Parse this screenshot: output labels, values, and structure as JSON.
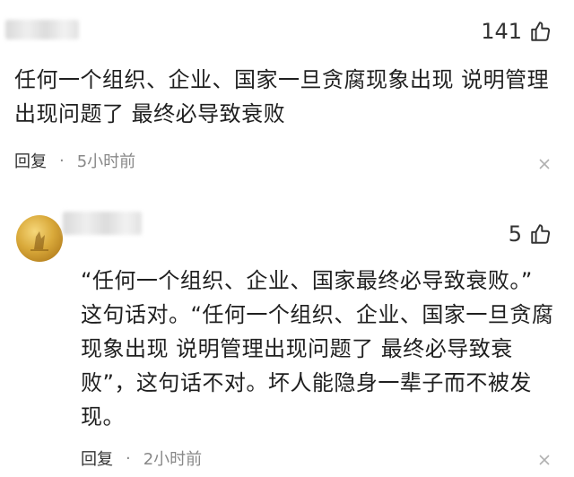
{
  "comments": [
    {
      "likes": "141",
      "text": "任何一个组织、企业、国家一旦贪腐现象出现 说明管理出现问题了 最终必导致衰败",
      "reply_label": "回复",
      "separator": "·",
      "time": "5小时前"
    },
    {
      "likes": "5",
      "text": "“任何一个组织、企业、国家最终必导致衰败。” 这句话对。“任何一个组织、企业、国家一旦贪腐现象出现 说明管理出现问题了 最终必导致衰败”，这句话不对。坏人能隐身一辈子而不被发现。",
      "reply_label": "回复",
      "separator": "·",
      "time": "2小时前"
    }
  ],
  "icons": {
    "like": "thumbs-up-icon",
    "close": "close-icon"
  },
  "colors": {
    "avatar_gold": "#d9a93a",
    "meta_gray": "#888888"
  }
}
